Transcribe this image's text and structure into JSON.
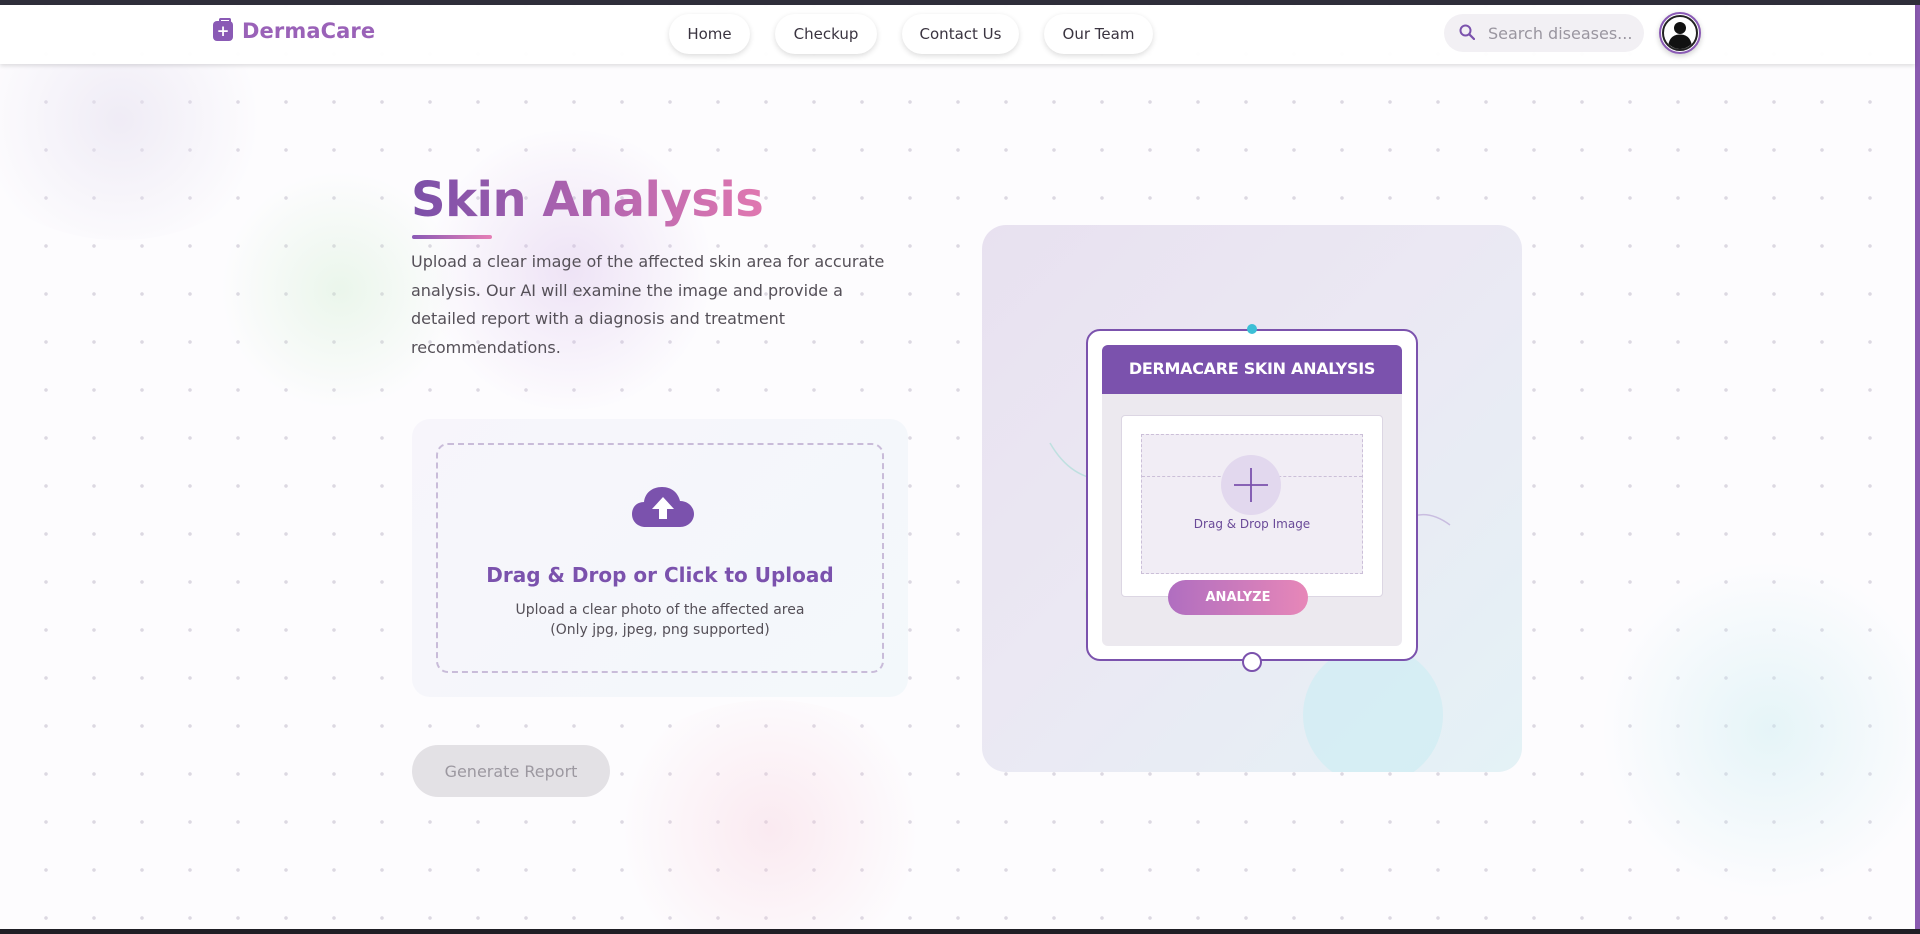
{
  "brand": {
    "name": "DermaCare"
  },
  "nav": {
    "links": [
      {
        "label": "Home"
      },
      {
        "label": "Checkup"
      },
      {
        "label": "Contact Us"
      },
      {
        "label": "Our Team"
      }
    ]
  },
  "search": {
    "placeholder": "Search diseases...",
    "value": ""
  },
  "main": {
    "title": "Skin Analysis",
    "description": "Upload a clear image of the affected skin area for accurate analysis. Our AI will examine the image and provide a detailed report with a diagnosis and treatment recommendations."
  },
  "upload": {
    "title": "Drag & Drop or Click to Upload",
    "subtitle": "Upload a clear photo of the affected area",
    "formats": "(Only jpg, jpeg, png supported)"
  },
  "actions": {
    "generate_label": "Generate Report"
  },
  "illustration": {
    "header": "DERMACARE SKIN ANALYSIS",
    "drop_label": "Drag & Drop Image",
    "analyze_label": "ANALYZE"
  },
  "colors": {
    "primary": "#7b52ad",
    "accent_pink": "#e67fb6",
    "disabled": "#e3e1e5",
    "teal": "#3cbfd6"
  },
  "icons": [
    "medical-kit-icon",
    "search-icon",
    "user-avatar-icon",
    "cloud-upload-icon",
    "plus-icon"
  ]
}
